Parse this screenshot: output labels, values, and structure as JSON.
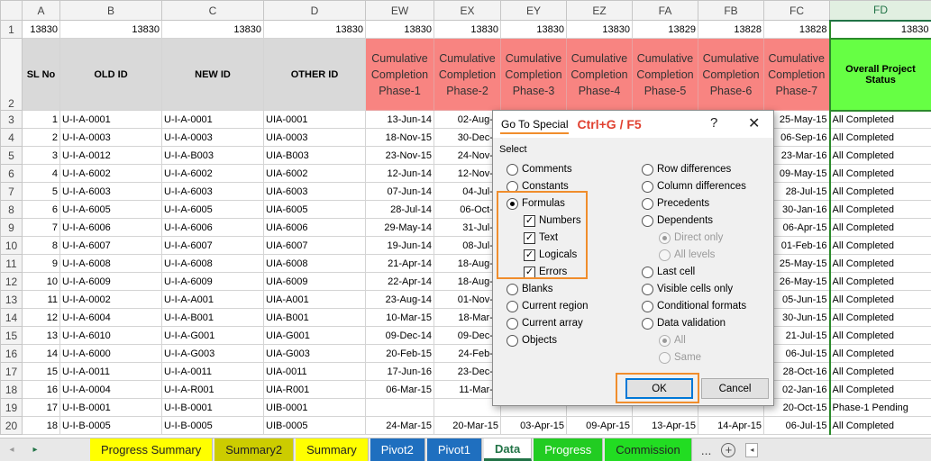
{
  "columns": [
    "A",
    "B",
    "C",
    "D",
    "EW",
    "EX",
    "EY",
    "EZ",
    "FA",
    "FB",
    "FC",
    "FD"
  ],
  "selected_column": "FD",
  "row1": [
    "13830",
    "13830",
    "13830",
    "13830",
    "13830",
    "13830",
    "13830",
    "13830",
    "13829",
    "13828",
    "13828",
    "13830"
  ],
  "headers": {
    "sl_no": "SL No",
    "old_id": "OLD ID",
    "new_id": "NEW ID",
    "other_id": "OTHER ID",
    "phases": [
      "Cumulative Completion Phase-1",
      "Cumulative Completion Phase-2",
      "Cumulative Completion Phase-3",
      "Cumulative Completion Phase-4",
      "Cumulative Completion Phase-5",
      "Cumulative Completion Phase-6",
      "Cumulative Completion Phase-7"
    ],
    "status": "Overall Project Status"
  },
  "rows": [
    {
      "num": "3",
      "sl": "1",
      "old": "U-I-A-0001",
      "new": "U-I-A-0001",
      "other": "UIA-0001",
      "p": [
        "13-Jun-14",
        "02-Aug-1",
        "",
        "",
        "",
        "",
        "25-May-15"
      ],
      "status": "All Completed"
    },
    {
      "num": "4",
      "sl": "2",
      "old": "U-I-A-0003",
      "new": "U-I-A-0003",
      "other": "UIA-0003",
      "p": [
        "18-Nov-15",
        "30-Dec-1",
        "",
        "",
        "",
        "",
        "06-Sep-16"
      ],
      "status": "All Completed"
    },
    {
      "num": "5",
      "sl": "3",
      "old": "U-I-A-0012",
      "new": "U-I-A-B003",
      "other": "UIA-B003",
      "p": [
        "23-Nov-15",
        "24-Nov-1",
        "",
        "",
        "",
        "",
        "23-Mar-16"
      ],
      "status": "All Completed"
    },
    {
      "num": "6",
      "sl": "4",
      "old": "U-I-A-6002",
      "new": "U-I-A-6002",
      "other": "UIA-6002",
      "p": [
        "12-Jun-14",
        "12-Nov-1",
        "",
        "",
        "",
        "",
        "09-May-15"
      ],
      "status": "All Completed"
    },
    {
      "num": "7",
      "sl": "5",
      "old": "U-I-A-6003",
      "new": "U-I-A-6003",
      "other": "UIA-6003",
      "p": [
        "07-Jun-14",
        "04-Jul-1",
        "",
        "",
        "",
        "",
        "28-Jul-15"
      ],
      "status": "All Completed"
    },
    {
      "num": "8",
      "sl": "6",
      "old": "U-I-A-6005",
      "new": "U-I-A-6005",
      "other": "UIA-6005",
      "p": [
        "28-Jul-14",
        "06-Oct-1",
        "",
        "",
        "",
        "",
        "30-Jan-16"
      ],
      "status": "All Completed"
    },
    {
      "num": "9",
      "sl": "7",
      "old": "U-I-A-6006",
      "new": "U-I-A-6006",
      "other": "UIA-6006",
      "p": [
        "29-May-14",
        "31-Jul-1",
        "",
        "",
        "",
        "",
        "06-Apr-15"
      ],
      "status": "All Completed"
    },
    {
      "num": "10",
      "sl": "8",
      "old": "U-I-A-6007",
      "new": "U-I-A-6007",
      "other": "UIA-6007",
      "p": [
        "19-Jun-14",
        "08-Jul-1",
        "",
        "",
        "",
        "",
        "01-Feb-16"
      ],
      "status": "All Completed"
    },
    {
      "num": "11",
      "sl": "9",
      "old": "U-I-A-6008",
      "new": "U-I-A-6008",
      "other": "UIA-6008",
      "p": [
        "21-Apr-14",
        "18-Aug-1",
        "",
        "",
        "",
        "",
        "25-May-15"
      ],
      "status": "All Completed"
    },
    {
      "num": "12",
      "sl": "10",
      "old": "U-I-A-6009",
      "new": "U-I-A-6009",
      "other": "UIA-6009",
      "p": [
        "22-Apr-14",
        "18-Aug-1",
        "",
        "",
        "",
        "",
        "26-May-15"
      ],
      "status": "All Completed"
    },
    {
      "num": "13",
      "sl": "11",
      "old": "U-I-A-0002",
      "new": "U-I-A-A001",
      "other": "UIA-A001",
      "p": [
        "23-Aug-14",
        "01-Nov-1",
        "",
        "",
        "",
        "",
        "05-Jun-15"
      ],
      "status": "All Completed"
    },
    {
      "num": "14",
      "sl": "12",
      "old": "U-I-A-6004",
      "new": "U-I-A-B001",
      "other": "UIA-B001",
      "p": [
        "10-Mar-15",
        "18-Mar-1",
        "",
        "",
        "",
        "",
        "30-Jun-15"
      ],
      "status": "All Completed"
    },
    {
      "num": "15",
      "sl": "13",
      "old": "U-I-A-6010",
      "new": "U-I-A-G001",
      "other": "UIA-G001",
      "p": [
        "09-Dec-14",
        "09-Dec-1",
        "",
        "",
        "",
        "",
        "21-Jul-15"
      ],
      "status": "All Completed"
    },
    {
      "num": "16",
      "sl": "14",
      "old": "U-I-A-6000",
      "new": "U-I-A-G003",
      "other": "UIA-G003",
      "p": [
        "20-Feb-15",
        "24-Feb-1",
        "",
        "",
        "",
        "",
        "06-Jul-15"
      ],
      "status": "All Completed"
    },
    {
      "num": "17",
      "sl": "15",
      "old": "U-I-A-0011",
      "new": "U-I-A-0011",
      "other": "UIA-0011",
      "p": [
        "17-Jun-16",
        "23-Dec-1",
        "",
        "",
        "",
        "",
        "28-Oct-16"
      ],
      "status": "All Completed"
    },
    {
      "num": "18",
      "sl": "16",
      "old": "U-I-A-0004",
      "new": "U-I-A-R001",
      "other": "UIA-R001",
      "p": [
        "06-Mar-15",
        "11-Mar-1",
        "",
        "",
        "",
        "",
        "02-Jan-16"
      ],
      "status": "All Completed"
    },
    {
      "num": "19",
      "sl": "17",
      "old": "U-I-B-0001",
      "new": "U-I-B-0001",
      "other": "UIB-0001",
      "p": [
        "",
        "",
        "",
        "",
        "",
        "",
        "20-Oct-15"
      ],
      "status": "Phase-1 Pending"
    },
    {
      "num": "20",
      "sl": "18",
      "old": "U-I-B-0005",
      "new": "U-I-B-0005",
      "other": "UIB-0005",
      "p": [
        "24-Mar-15",
        "20-Mar-15",
        "03-Apr-15",
        "09-Apr-15",
        "13-Apr-15",
        "14-Apr-15",
        "06-Jul-15"
      ],
      "status": "All Completed"
    }
  ],
  "dialog": {
    "title": "Go To Special",
    "shortcut": "Ctrl+G / F5",
    "help": "?",
    "close": "✕",
    "select_label": "Select",
    "ok": "OK",
    "cancel": "Cancel",
    "left_options": [
      {
        "label": "Comments",
        "type": "radio",
        "checked": false
      },
      {
        "label": "Constants",
        "type": "radio",
        "checked": false
      },
      {
        "label": "Formulas",
        "type": "radio",
        "checked": true
      },
      {
        "label": "Numbers",
        "type": "check",
        "checked": true
      },
      {
        "label": "Text",
        "type": "check",
        "checked": true
      },
      {
        "label": "Logicals",
        "type": "check",
        "checked": true
      },
      {
        "label": "Errors",
        "type": "check",
        "checked": true
      },
      {
        "label": "Blanks",
        "type": "radio",
        "checked": false
      },
      {
        "label": "Current region",
        "type": "radio",
        "checked": false
      },
      {
        "label": "Current array",
        "type": "radio",
        "checked": false
      },
      {
        "label": "Objects",
        "type": "radio",
        "checked": false
      }
    ],
    "right_options": [
      {
        "label": "Row differences",
        "type": "radio",
        "checked": false,
        "disabled": false
      },
      {
        "label": "Column differences",
        "type": "radio",
        "checked": false,
        "disabled": false
      },
      {
        "label": "Precedents",
        "type": "radio",
        "checked": false,
        "disabled": false
      },
      {
        "label": "Dependents",
        "type": "radio",
        "checked": false,
        "disabled": false
      },
      {
        "label": "Direct only",
        "type": "radio",
        "checked": true,
        "disabled": true
      },
      {
        "label": "All levels",
        "type": "radio",
        "checked": false,
        "disabled": true
      },
      {
        "label": "Last cell",
        "type": "radio",
        "checked": false,
        "disabled": false
      },
      {
        "label": "Visible cells only",
        "type": "radio",
        "checked": false,
        "disabled": false
      },
      {
        "label": "Conditional formats",
        "type": "radio",
        "checked": false,
        "disabled": false
      },
      {
        "label": "Data validation",
        "type": "radio",
        "checked": false,
        "disabled": false
      },
      {
        "label": "All",
        "type": "radio",
        "checked": true,
        "disabled": true
      },
      {
        "label": "Same",
        "type": "radio",
        "checked": false,
        "disabled": true
      }
    ]
  },
  "tabs": [
    {
      "label": "Progress Summary",
      "color": "#ffff00",
      "text": "#222222",
      "active": false
    },
    {
      "label": "Summary2",
      "color": "#cccc00",
      "text": "#222222",
      "active": false
    },
    {
      "label": "Summary",
      "color": "#ffff00",
      "text": "#222222",
      "active": false
    },
    {
      "label": "Pivot2",
      "color": "#1f6fbf",
      "text": "#ffffff",
      "active": false
    },
    {
      "label": "Pivot1",
      "color": "#1f6fbf",
      "text": "#ffffff",
      "active": false
    },
    {
      "label": "Data",
      "color": "#ffffff",
      "text": "#217346",
      "active": true
    },
    {
      "label": "Progress",
      "color": "#22cc22",
      "text": "#ffffff",
      "active": false
    },
    {
      "label": "Commission",
      "color": "#22dd22",
      "text": "#222222",
      "active": false
    }
  ],
  "tabs_more": "...",
  "tabs_add": "+",
  "nav_left": "◂",
  "nav_right": "▸",
  "scroll_left": "◂"
}
